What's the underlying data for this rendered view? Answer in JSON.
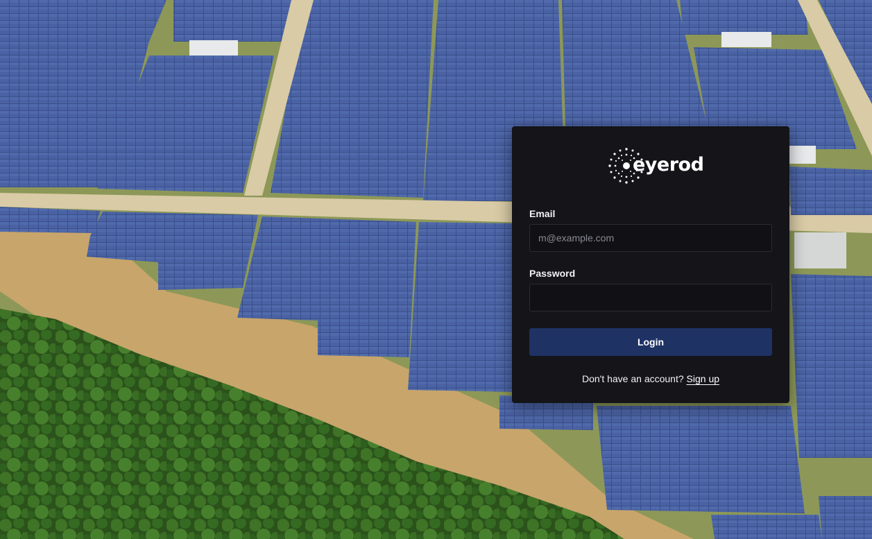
{
  "background": {
    "description_colors": {
      "panel_blue": "#3f5592",
      "panel_dark": "#2d3f73",
      "road": "#d6c7a2",
      "dirt": "#c9a46a",
      "grass": "#9aa35a",
      "forest": "#2f5a1d"
    }
  },
  "login": {
    "logo_text": "eyerod",
    "email_label": "Email",
    "email_placeholder": "m@example.com",
    "email_value": "",
    "password_label": "Password",
    "password_value": "",
    "login_button": "Login",
    "signup_prompt": "Don't have an account?",
    "signup_link": "Sign up",
    "colors": {
      "card_bg": "#141419",
      "input_bg": "#101015",
      "button_bg": "#1f3264",
      "text": "#f2f2f5"
    }
  }
}
